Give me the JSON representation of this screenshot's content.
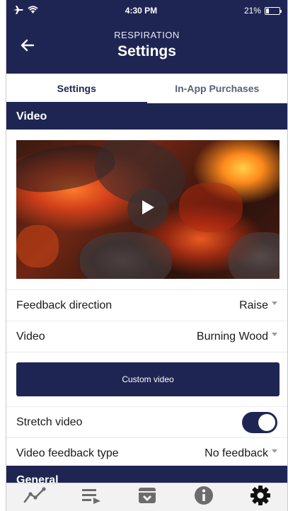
{
  "status_bar": {
    "time": "4:30 PM",
    "battery_percent": "21%",
    "battery_level": 0.21,
    "icons": [
      "airplane-icon",
      "wifi-icon",
      "battery-icon"
    ]
  },
  "header": {
    "subtitle": "RESPIRATION",
    "title": "Settings",
    "back_icon": "back-arrow-icon"
  },
  "tabs": [
    {
      "label": "Settings",
      "active": true
    },
    {
      "label": "In-App Purchases",
      "active": false
    }
  ],
  "video_section": {
    "title": "Video",
    "thumbnail_icon": "play-icon",
    "rows": {
      "feedback_direction": {
        "label": "Feedback direction",
        "value": "Raise"
      },
      "video": {
        "label": "Video",
        "value": "Burning Wood"
      }
    },
    "custom_video_label": "Custom video",
    "stretch": {
      "label": "Stretch video",
      "enabled": true
    },
    "feedback_type": {
      "label": "Video feedback type",
      "value": "No feedback"
    }
  },
  "general_section": {
    "title": "General"
  },
  "bottom_nav": [
    {
      "icon": "graph-icon"
    },
    {
      "icon": "playlist-icon"
    },
    {
      "icon": "archive-icon"
    },
    {
      "icon": "info-icon"
    },
    {
      "icon": "gear-icon",
      "active": true
    }
  ],
  "colors": {
    "primary": "#1f2553",
    "inactive_icon": "#6c6c6c",
    "active_icon": "#111111"
  }
}
